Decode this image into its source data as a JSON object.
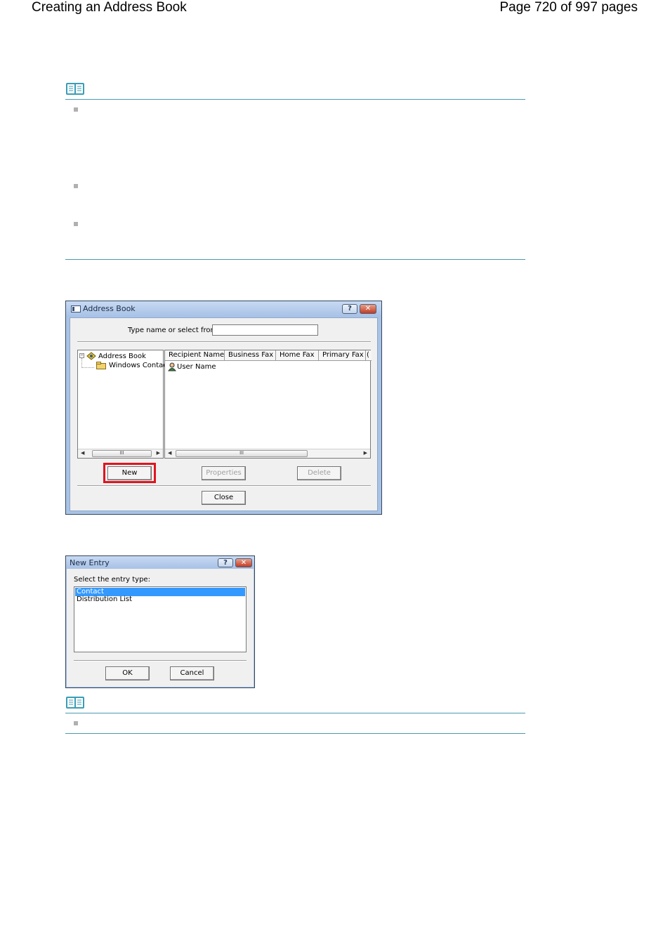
{
  "header": {
    "title": "Creating an Address Book",
    "page": "Page 720 of 997 pages"
  },
  "address_book": {
    "window_title": "Address Book",
    "help_glyph": "?",
    "close_glyph": "✕",
    "type_label": "Type name or select from list:",
    "type_value": "",
    "tree": {
      "root": "Address Book",
      "child": "Windows Contacts"
    },
    "columns": [
      "Recipient Name",
      "Business Fax",
      "Home Fax",
      "Primary Fax",
      "("
    ],
    "rows": [
      "User Name"
    ],
    "scroll_grip": "III",
    "buttons": {
      "new": "New",
      "properties": "Properties",
      "delete": "Delete",
      "close": "Close"
    },
    "highlight_color": "#e0141e"
  },
  "new_entry": {
    "window_title": "New Entry",
    "help_glyph": "?",
    "close_glyph": "✕",
    "prompt": "Select the entry type:",
    "options": [
      "Contact",
      "Distribution List"
    ],
    "selected": "Contact",
    "buttons": {
      "ok": "OK",
      "cancel": "Cancel"
    }
  },
  "icons": {
    "note": "note-book-icon",
    "tree_root": "address-book-icon",
    "tree_child": "folder-icon",
    "contact": "contact-user-icon"
  }
}
